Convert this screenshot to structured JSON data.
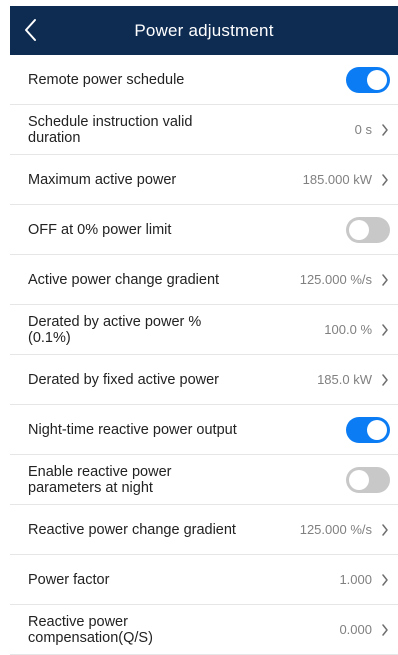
{
  "header": {
    "title": "Power adjustment",
    "back_icon": "chevron-left-icon"
  },
  "settings": [
    {
      "label": "Remote power schedule",
      "type": "toggle",
      "state": "on"
    },
    {
      "label": "Schedule instruction valid duration",
      "type": "value",
      "value": "0 s"
    },
    {
      "label": "Maximum active power",
      "type": "value",
      "value": "185.000 kW"
    },
    {
      "label": "OFF at 0% power limit",
      "type": "toggle",
      "state": "off"
    },
    {
      "label": "Active power change gradient",
      "type": "value",
      "value": "125.000 %/s"
    },
    {
      "label": "Derated by active power % (0.1%)",
      "type": "value",
      "value": "100.0 %"
    },
    {
      "label": "Derated by fixed active power",
      "type": "value",
      "value": "185.0 kW"
    },
    {
      "label": "Night-time reactive power output",
      "type": "toggle",
      "state": "on"
    },
    {
      "label": "Enable reactive power parameters at night",
      "type": "toggle",
      "state": "off"
    },
    {
      "label": "Reactive power change gradient",
      "type": "value",
      "value": "125.000 %/s"
    },
    {
      "label": "Power factor",
      "type": "value",
      "value": "1.000"
    },
    {
      "label": "Reactive power compensation(Q/S)",
      "type": "value",
      "value": "0.000"
    }
  ],
  "colors": {
    "header_bg": "#0e2c52",
    "toggle_on": "#0b7cf4",
    "toggle_off": "#c8c8c8",
    "value_text": "#808080"
  }
}
